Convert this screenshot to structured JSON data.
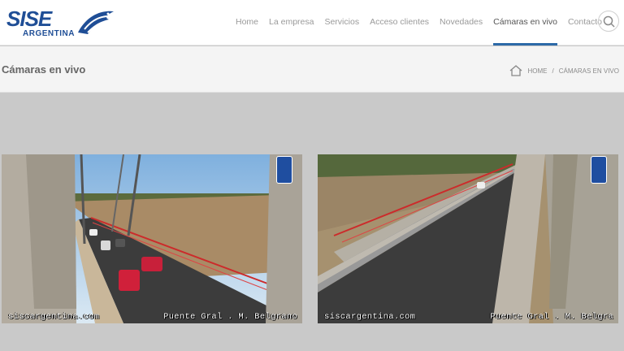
{
  "brand": {
    "name": "SISE",
    "subtitle": "ARGENTINA"
  },
  "nav": {
    "items": [
      {
        "label": "Home"
      },
      {
        "label": "La empresa"
      },
      {
        "label": "Servicios"
      },
      {
        "label": "Acceso clientes"
      },
      {
        "label": "Novedades"
      },
      {
        "label": "Cámaras en vivo",
        "active": true
      },
      {
        "label": "Contacto"
      }
    ],
    "search_icon": "search-icon"
  },
  "page": {
    "title": "Cámaras en vivo",
    "breadcrumb": {
      "home": "HOME",
      "separator": "/",
      "current": "CÁMARAS EN VIVO"
    }
  },
  "cameras": [
    {
      "site": "siscargentina.com",
      "location": "Puente Gral . M. Belgrano"
    },
    {
      "site": "siscargentina.com",
      "location": "Puente Gral . M. Belgra"
    }
  ],
  "colors": {
    "brand": "#1f4e96",
    "accent": "#2d6aa8",
    "page_bg": "#c9c9c9"
  }
}
